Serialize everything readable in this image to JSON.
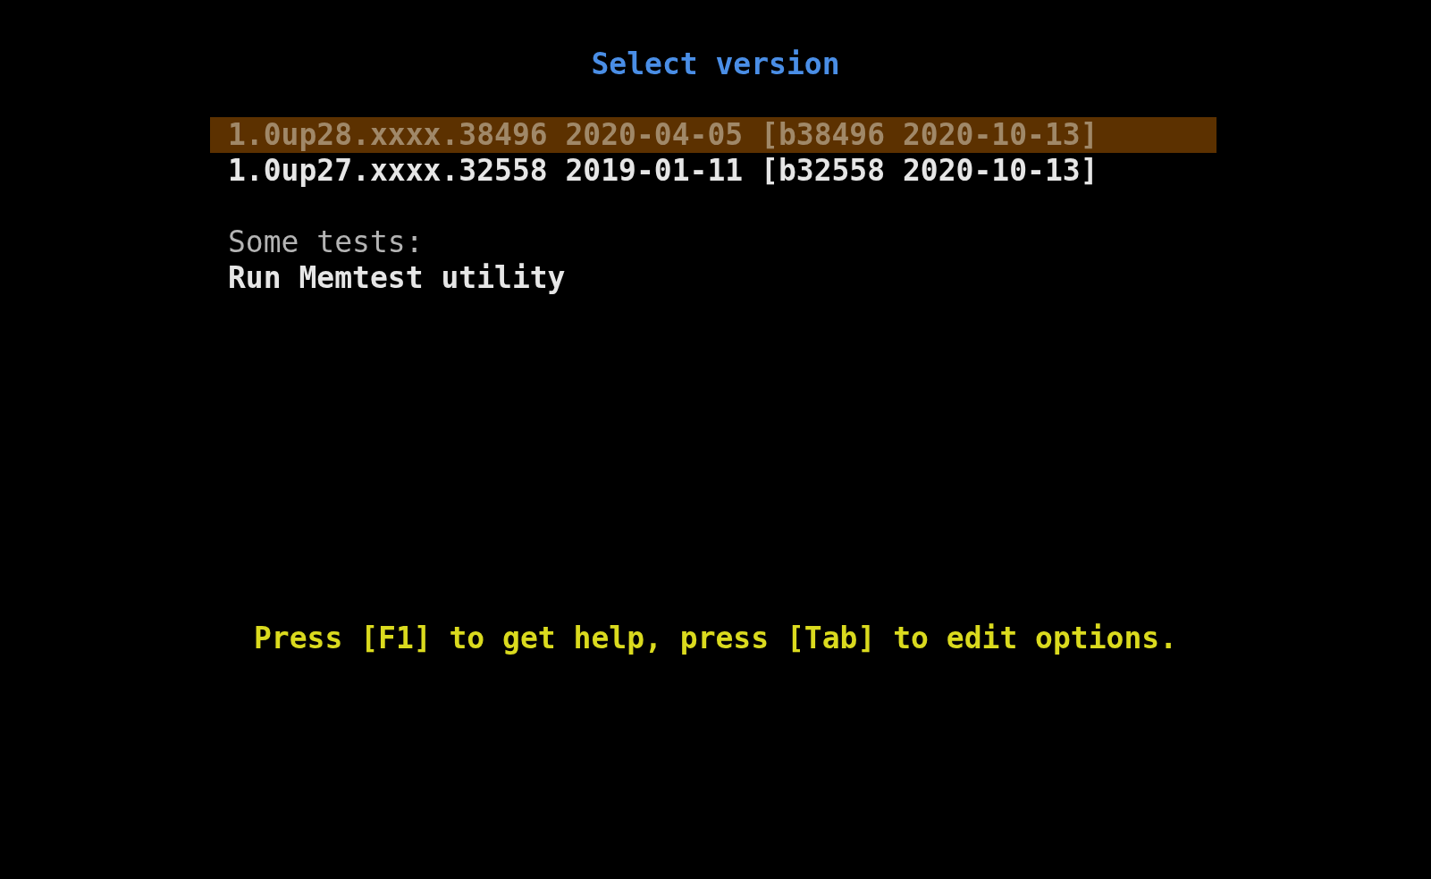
{
  "title": "Select version",
  "menu": [
    {
      "label": "1.0up28.xxxx.38496 2020-04-05 [b38496 2020-10-13]",
      "selected": true
    },
    {
      "label": "1.0up27.xxxx.32558 2019-01-11 [b32558 2020-10-13]",
      "selected": false
    }
  ],
  "sections": [
    {
      "heading": "Some tests:",
      "items": [
        {
          "label": "Run Memtest utility",
          "selected": false
        }
      ]
    }
  ],
  "help": "Press [F1] to get help, press [Tab] to edit options."
}
